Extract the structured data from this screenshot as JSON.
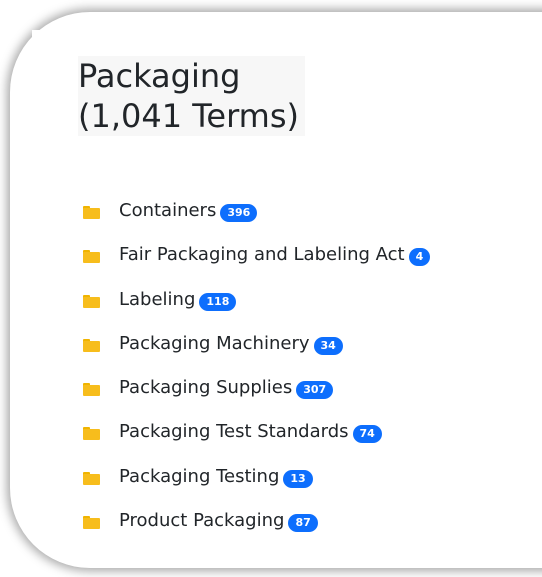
{
  "header": {
    "title_line1": "Packaging",
    "title_line2": "(1,041 Terms)"
  },
  "categories": [
    {
      "label": "Containers",
      "count": "396"
    },
    {
      "label": "Fair Packaging and Labeling Act",
      "count": "4"
    },
    {
      "label": "Labeling",
      "count": "118"
    },
    {
      "label": "Packaging Machinery",
      "count": "34"
    },
    {
      "label": "Packaging Supplies",
      "count": "307"
    },
    {
      "label": "Packaging Test Standards",
      "count": "74"
    },
    {
      "label": "Packaging Testing",
      "count": "13"
    },
    {
      "label": "Product Packaging",
      "count": "87"
    }
  ],
  "icons": {
    "folder": "folder-icon"
  },
  "colors": {
    "badge": "#0d6efd",
    "folder": "#f7bd1c",
    "text": "#212529"
  }
}
